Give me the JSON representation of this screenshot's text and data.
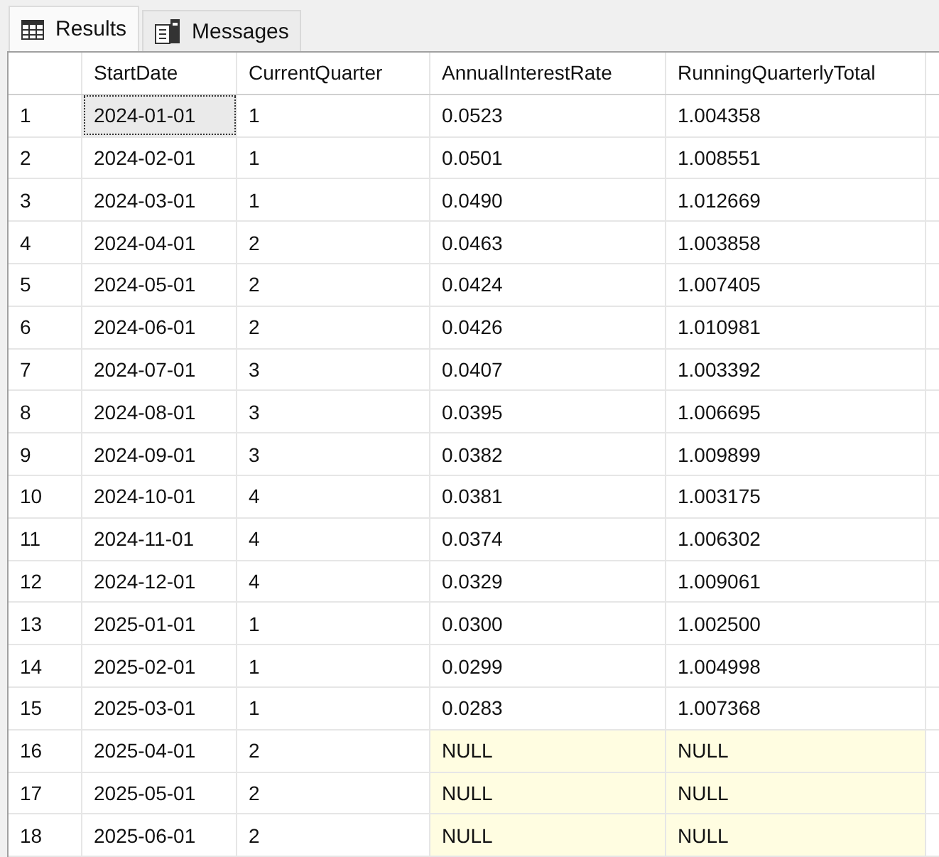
{
  "tabs": [
    {
      "label": "Results",
      "selected": true,
      "kind": "grid"
    },
    {
      "label": "Messages",
      "selected": false,
      "kind": "messages"
    }
  ],
  "table": {
    "columns": [
      "StartDate",
      "CurrentQuarter",
      "AnnualInterestRate",
      "RunningQuarterlyTotal"
    ],
    "rows": [
      {
        "number": "1",
        "cells": [
          {
            "text": "2024-01-01",
            "null": false,
            "selected": true
          },
          {
            "text": "1",
            "null": false,
            "selected": false
          },
          {
            "text": "0.0523",
            "null": false,
            "selected": false
          },
          {
            "text": "1.004358",
            "null": false,
            "selected": false
          }
        ]
      },
      {
        "number": "2",
        "cells": [
          {
            "text": "2024-02-01",
            "null": false,
            "selected": false
          },
          {
            "text": "1",
            "null": false,
            "selected": false
          },
          {
            "text": "0.0501",
            "null": false,
            "selected": false
          },
          {
            "text": "1.008551",
            "null": false,
            "selected": false
          }
        ]
      },
      {
        "number": "3",
        "cells": [
          {
            "text": "2024-03-01",
            "null": false,
            "selected": false
          },
          {
            "text": "1",
            "null": false,
            "selected": false
          },
          {
            "text": "0.0490",
            "null": false,
            "selected": false
          },
          {
            "text": "1.012669",
            "null": false,
            "selected": false
          }
        ]
      },
      {
        "number": "4",
        "cells": [
          {
            "text": "2024-04-01",
            "null": false,
            "selected": false
          },
          {
            "text": "2",
            "null": false,
            "selected": false
          },
          {
            "text": "0.0463",
            "null": false,
            "selected": false
          },
          {
            "text": "1.003858",
            "null": false,
            "selected": false
          }
        ]
      },
      {
        "number": "5",
        "cells": [
          {
            "text": "2024-05-01",
            "null": false,
            "selected": false
          },
          {
            "text": "2",
            "null": false,
            "selected": false
          },
          {
            "text": "0.0424",
            "null": false,
            "selected": false
          },
          {
            "text": "1.007405",
            "null": false,
            "selected": false
          }
        ]
      },
      {
        "number": "6",
        "cells": [
          {
            "text": "2024-06-01",
            "null": false,
            "selected": false
          },
          {
            "text": "2",
            "null": false,
            "selected": false
          },
          {
            "text": "0.0426",
            "null": false,
            "selected": false
          },
          {
            "text": "1.010981",
            "null": false,
            "selected": false
          }
        ]
      },
      {
        "number": "7",
        "cells": [
          {
            "text": "2024-07-01",
            "null": false,
            "selected": false
          },
          {
            "text": "3",
            "null": false,
            "selected": false
          },
          {
            "text": "0.0407",
            "null": false,
            "selected": false
          },
          {
            "text": "1.003392",
            "null": false,
            "selected": false
          }
        ]
      },
      {
        "number": "8",
        "cells": [
          {
            "text": "2024-08-01",
            "null": false,
            "selected": false
          },
          {
            "text": "3",
            "null": false,
            "selected": false
          },
          {
            "text": "0.0395",
            "null": false,
            "selected": false
          },
          {
            "text": "1.006695",
            "null": false,
            "selected": false
          }
        ]
      },
      {
        "number": "9",
        "cells": [
          {
            "text": "2024-09-01",
            "null": false,
            "selected": false
          },
          {
            "text": "3",
            "null": false,
            "selected": false
          },
          {
            "text": "0.0382",
            "null": false,
            "selected": false
          },
          {
            "text": "1.009899",
            "null": false,
            "selected": false
          }
        ]
      },
      {
        "number": "10",
        "cells": [
          {
            "text": "2024-10-01",
            "null": false,
            "selected": false
          },
          {
            "text": "4",
            "null": false,
            "selected": false
          },
          {
            "text": "0.0381",
            "null": false,
            "selected": false
          },
          {
            "text": "1.003175",
            "null": false,
            "selected": false
          }
        ]
      },
      {
        "number": "11",
        "cells": [
          {
            "text": "2024-11-01",
            "null": false,
            "selected": false
          },
          {
            "text": "4",
            "null": false,
            "selected": false
          },
          {
            "text": "0.0374",
            "null": false,
            "selected": false
          },
          {
            "text": "1.006302",
            "null": false,
            "selected": false
          }
        ]
      },
      {
        "number": "12",
        "cells": [
          {
            "text": "2024-12-01",
            "null": false,
            "selected": false
          },
          {
            "text": "4",
            "null": false,
            "selected": false
          },
          {
            "text": "0.0329",
            "null": false,
            "selected": false
          },
          {
            "text": "1.009061",
            "null": false,
            "selected": false
          }
        ]
      },
      {
        "number": "13",
        "cells": [
          {
            "text": "2025-01-01",
            "null": false,
            "selected": false
          },
          {
            "text": "1",
            "null": false,
            "selected": false
          },
          {
            "text": "0.0300",
            "null": false,
            "selected": false
          },
          {
            "text": "1.002500",
            "null": false,
            "selected": false
          }
        ]
      },
      {
        "number": "14",
        "cells": [
          {
            "text": "2025-02-01",
            "null": false,
            "selected": false
          },
          {
            "text": "1",
            "null": false,
            "selected": false
          },
          {
            "text": "0.0299",
            "null": false,
            "selected": false
          },
          {
            "text": "1.004998",
            "null": false,
            "selected": false
          }
        ]
      },
      {
        "number": "15",
        "cells": [
          {
            "text": "2025-03-01",
            "null": false,
            "selected": false
          },
          {
            "text": "1",
            "null": false,
            "selected": false
          },
          {
            "text": "0.0283",
            "null": false,
            "selected": false
          },
          {
            "text": "1.007368",
            "null": false,
            "selected": false
          }
        ]
      },
      {
        "number": "16",
        "cells": [
          {
            "text": "2025-04-01",
            "null": false,
            "selected": false
          },
          {
            "text": "2",
            "null": false,
            "selected": false
          },
          {
            "text": "NULL",
            "null": true,
            "selected": false
          },
          {
            "text": "NULL",
            "null": true,
            "selected": false
          }
        ]
      },
      {
        "number": "17",
        "cells": [
          {
            "text": "2025-05-01",
            "null": false,
            "selected": false
          },
          {
            "text": "2",
            "null": false,
            "selected": false
          },
          {
            "text": "NULL",
            "null": true,
            "selected": false
          },
          {
            "text": "NULL",
            "null": true,
            "selected": false
          }
        ]
      },
      {
        "number": "18",
        "cells": [
          {
            "text": "2025-06-01",
            "null": false,
            "selected": false
          },
          {
            "text": "2",
            "null": false,
            "selected": false
          },
          {
            "text": "NULL",
            "null": true,
            "selected": false
          },
          {
            "text": "NULL",
            "null": true,
            "selected": false
          }
        ]
      }
    ]
  }
}
